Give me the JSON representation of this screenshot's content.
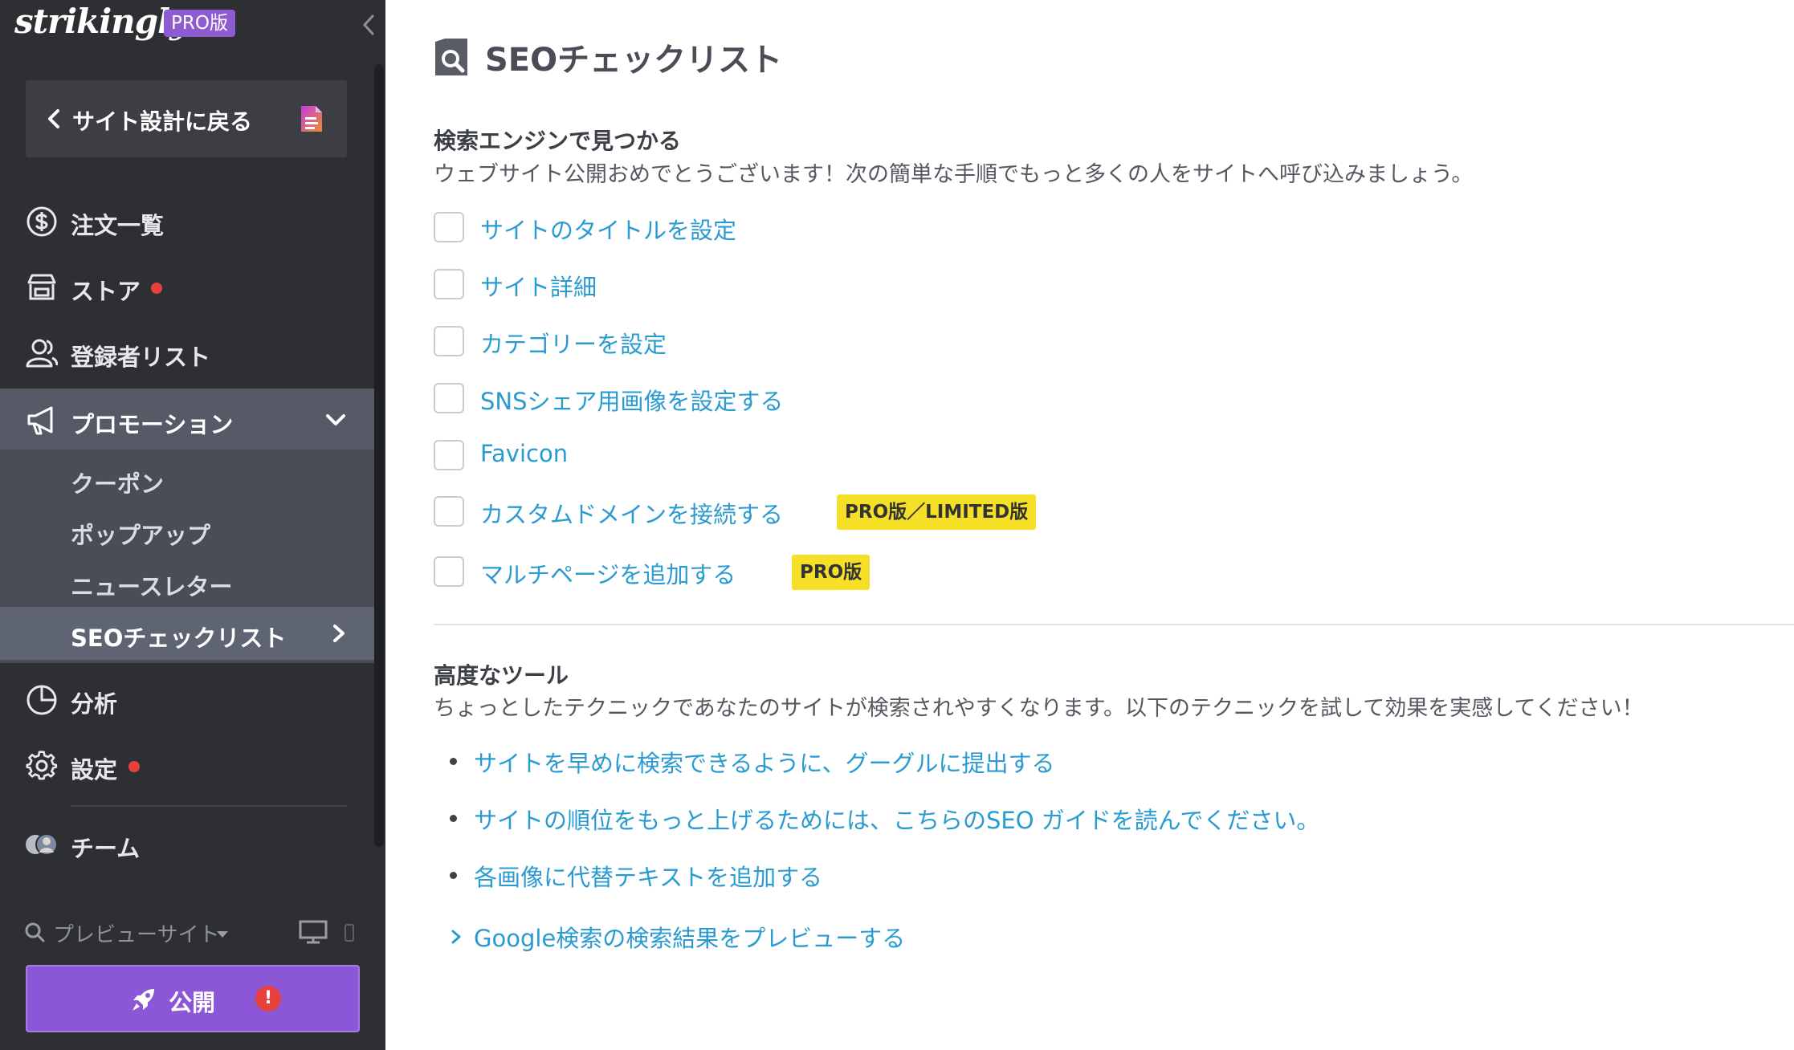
{
  "sidebar": {
    "brand": "strikingly",
    "plan_badge": "PRO版",
    "back_button": "サイト設計に戻る",
    "nav": {
      "orders": "注文一覧",
      "store": "ストア",
      "subscribers": "登録者リスト",
      "promotion": "プロモーション",
      "analytics": "分析",
      "settings": "設定",
      "team": "チーム"
    },
    "promotion_sub": [
      "クーポン",
      "ポップアップ",
      "ニュースレター",
      "SEOチェックリスト"
    ],
    "preview_label": "プレビューサイト",
    "publish_label": "公開",
    "publish_alert": "!"
  },
  "main": {
    "title": "SEOチェックリスト",
    "find_section": {
      "heading": "検索エンジンで見つかる",
      "description": "ウェブサイト公開おめでとうございます！次の簡単な手順でもっと多くの人をサイトへ呼び込みましょう。",
      "items": [
        "サイトのタイトルを設定",
        "サイト詳細",
        "カテゴリーを設定",
        "SNSシェア用画像を設定する",
        "Favicon",
        "カスタムドメインを接続する",
        "マルチページを追加する"
      ],
      "badges": {
        "custom_domain": "PRO版／LIMITED版",
        "multi_page": "PRO版"
      }
    },
    "advanced_section": {
      "heading": "高度なツール",
      "description": "ちょっとしたテクニックであなたのサイトが検索されやすくなります。以下のテクニックを試して効果を実感してください！",
      "links": [
        "サイトを早めに検索できるように、グーグルに提出する",
        "サイトの順位をもっと上げるためには、こちらのSEO ガイドを読んでください。",
        "各画像に代替テキストを追加する"
      ],
      "expander": "Google検索の検索結果をプレビューする"
    }
  },
  "colors": {
    "sidebar_bg": "#2e2f33",
    "accent_purple": "#8c57d6",
    "link_blue": "#2a9bd1",
    "badge_yellow": "#f6df27",
    "alert_red": "#e8413c"
  }
}
